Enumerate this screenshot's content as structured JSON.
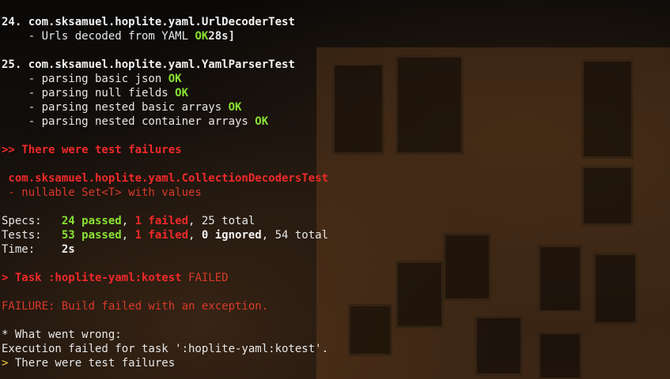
{
  "terminal": {
    "lines": [
      {
        "segments": [
          {
            "text": "24. com.sksamuel.hoplite.yaml.UrlDecoderTest",
            "style": "wb"
          }
        ]
      },
      {
        "segments": [
          {
            "text": "    - Urls decoded from YAML ",
            "style": ""
          },
          {
            "text": "OK",
            "style": "g"
          },
          {
            "text": "28s]",
            "style": "b"
          }
        ]
      },
      {
        "segments": []
      },
      {
        "segments": [
          {
            "text": "25. com.sksamuel.hoplite.yaml.YamlParserTest",
            "style": "wb"
          }
        ]
      },
      {
        "segments": [
          {
            "text": "    - parsing basic json ",
            "style": ""
          },
          {
            "text": "OK",
            "style": "g"
          }
        ]
      },
      {
        "segments": [
          {
            "text": "    - parsing null fields ",
            "style": ""
          },
          {
            "text": "OK",
            "style": "g"
          }
        ]
      },
      {
        "segments": [
          {
            "text": "    - parsing nested basic arrays ",
            "style": ""
          },
          {
            "text": "OK",
            "style": "g"
          }
        ]
      },
      {
        "segments": [
          {
            "text": "    - parsing nested container arrays ",
            "style": ""
          },
          {
            "text": "OK",
            "style": "g"
          }
        ]
      },
      {
        "segments": []
      },
      {
        "segments": [
          {
            "text": ">> There were test failures",
            "style": "rb"
          }
        ]
      },
      {
        "segments": []
      },
      {
        "segments": [
          {
            "text": " com.sksamuel.hoplite.yaml.CollectionDecodersTest",
            "style": "rb"
          }
        ]
      },
      {
        "segments": [
          {
            "text": " - nullable Set<T> with values",
            "style": "r"
          }
        ]
      },
      {
        "segments": []
      },
      {
        "segments": [
          {
            "text": "Specs:   ",
            "style": ""
          },
          {
            "text": "24 passed",
            "style": "g"
          },
          {
            "text": ", ",
            "style": ""
          },
          {
            "text": "1 failed",
            "style": "rb"
          },
          {
            "text": ", 25 total",
            "style": ""
          }
        ]
      },
      {
        "segments": [
          {
            "text": "Tests:   ",
            "style": ""
          },
          {
            "text": "53 passed",
            "style": "g"
          },
          {
            "text": ", ",
            "style": ""
          },
          {
            "text": "1 failed",
            "style": "rb"
          },
          {
            "text": ", ",
            "style": ""
          },
          {
            "text": "0 ignored",
            "style": "wb"
          },
          {
            "text": ", 54 total",
            "style": ""
          }
        ]
      },
      {
        "segments": [
          {
            "text": "Time:    ",
            "style": ""
          },
          {
            "text": "2s",
            "style": "wb"
          }
        ]
      },
      {
        "segments": []
      },
      {
        "segments": [
          {
            "text": "> Task :hoplite-yaml:kotest ",
            "style": "rb"
          },
          {
            "text": "FAILED",
            "style": "r"
          }
        ]
      },
      {
        "segments": []
      },
      {
        "segments": [
          {
            "text": "FAILURE: Build failed with an exception.",
            "style": "r"
          }
        ]
      },
      {
        "segments": []
      },
      {
        "segments": [
          {
            "text": "* What went wrong:",
            "style": ""
          }
        ]
      },
      {
        "segments": [
          {
            "text": "Execution failed for task ':hoplite-yaml:kotest'.",
            "style": ""
          }
        ]
      },
      {
        "segments": [
          {
            "text": "> ",
            "style": "y"
          },
          {
            "text": "There were test failures",
            "style": ""
          }
        ]
      }
    ]
  },
  "colors": {
    "ok_green": "#8ae234",
    "failure_red": "#ef2929",
    "dim_red": "#d83a2a",
    "prompt_yellow": "#f0c63a",
    "text": "#e7e7e7"
  }
}
